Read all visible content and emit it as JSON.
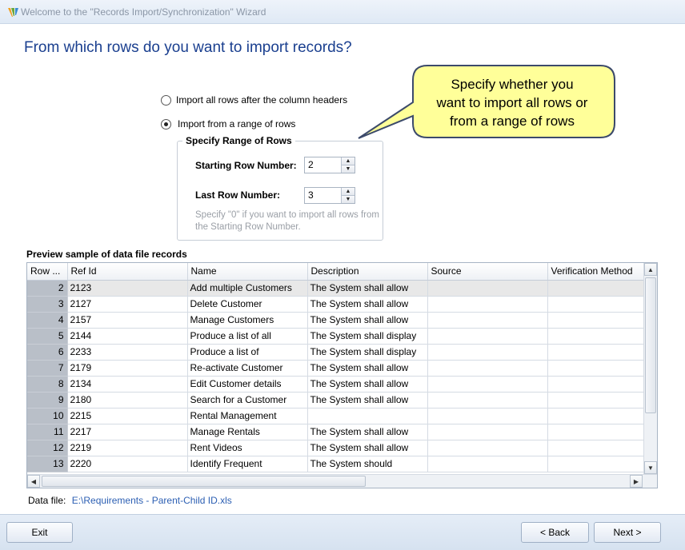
{
  "window": {
    "title": "Welcome to the \"Records Import/Synchronization\" Wizard"
  },
  "heading": "From which rows do you want to import records?",
  "options": {
    "all_rows_label": "Import all rows after the column headers",
    "range_label": "Import from a range of rows",
    "selected": "range"
  },
  "range": {
    "group_title": "Specify Range of Rows",
    "start_label": "Starting Row Number:",
    "start_value": "2",
    "last_label": "Last Row Number:",
    "last_value": "3",
    "hint": "Specify \"0\" if you want to import all rows from the Starting Row Number."
  },
  "callout": {
    "lines": [
      "Specify whether you",
      "want to import all rows or",
      "from a range of rows"
    ],
    "fill": "#ffff99",
    "border": "#3c4a6b"
  },
  "preview": {
    "label": "Preview sample of data file records",
    "columns": [
      "Row ...",
      "Ref Id",
      "Name",
      "Description",
      "Source",
      "Verification Method"
    ],
    "rows": [
      [
        "2",
        "2123",
        "Add  multiple Customers",
        "The System shall allow",
        "",
        ""
      ],
      [
        "3",
        "2127",
        "Delete Customer",
        "The System shall allow",
        "",
        ""
      ],
      [
        "4",
        "2157",
        "Manage Customers",
        "The System shall allow",
        "",
        ""
      ],
      [
        "5",
        "2144",
        "Produce a list of all",
        "The System shall display",
        "",
        ""
      ],
      [
        "6",
        "2233",
        "Produce a list of",
        "The System shall display",
        "",
        ""
      ],
      [
        "7",
        "2179",
        "Re-activate Customer",
        "The System shall allow",
        "",
        ""
      ],
      [
        "8",
        "2134",
        "Edit Customer details",
        "The System shall allow",
        "",
        ""
      ],
      [
        "9",
        "2180",
        "Search for a Customer",
        "The System shall allow",
        "",
        ""
      ],
      [
        "10",
        "2215",
        "Rental Management",
        "",
        "",
        ""
      ],
      [
        "11",
        "2217",
        "Manage Rentals",
        "The System shall allow",
        "",
        ""
      ],
      [
        "12",
        "2219",
        "Rent Videos",
        "The System shall allow",
        "",
        ""
      ],
      [
        "13",
        "2220",
        "Identify Frequent",
        "The System should",
        "",
        ""
      ]
    ]
  },
  "datafile": {
    "label": "Data file:",
    "path": "E:\\Requirements - Parent-Child ID.xls"
  },
  "buttons": {
    "exit": "Exit",
    "back": "< Back",
    "next": "Next >"
  }
}
